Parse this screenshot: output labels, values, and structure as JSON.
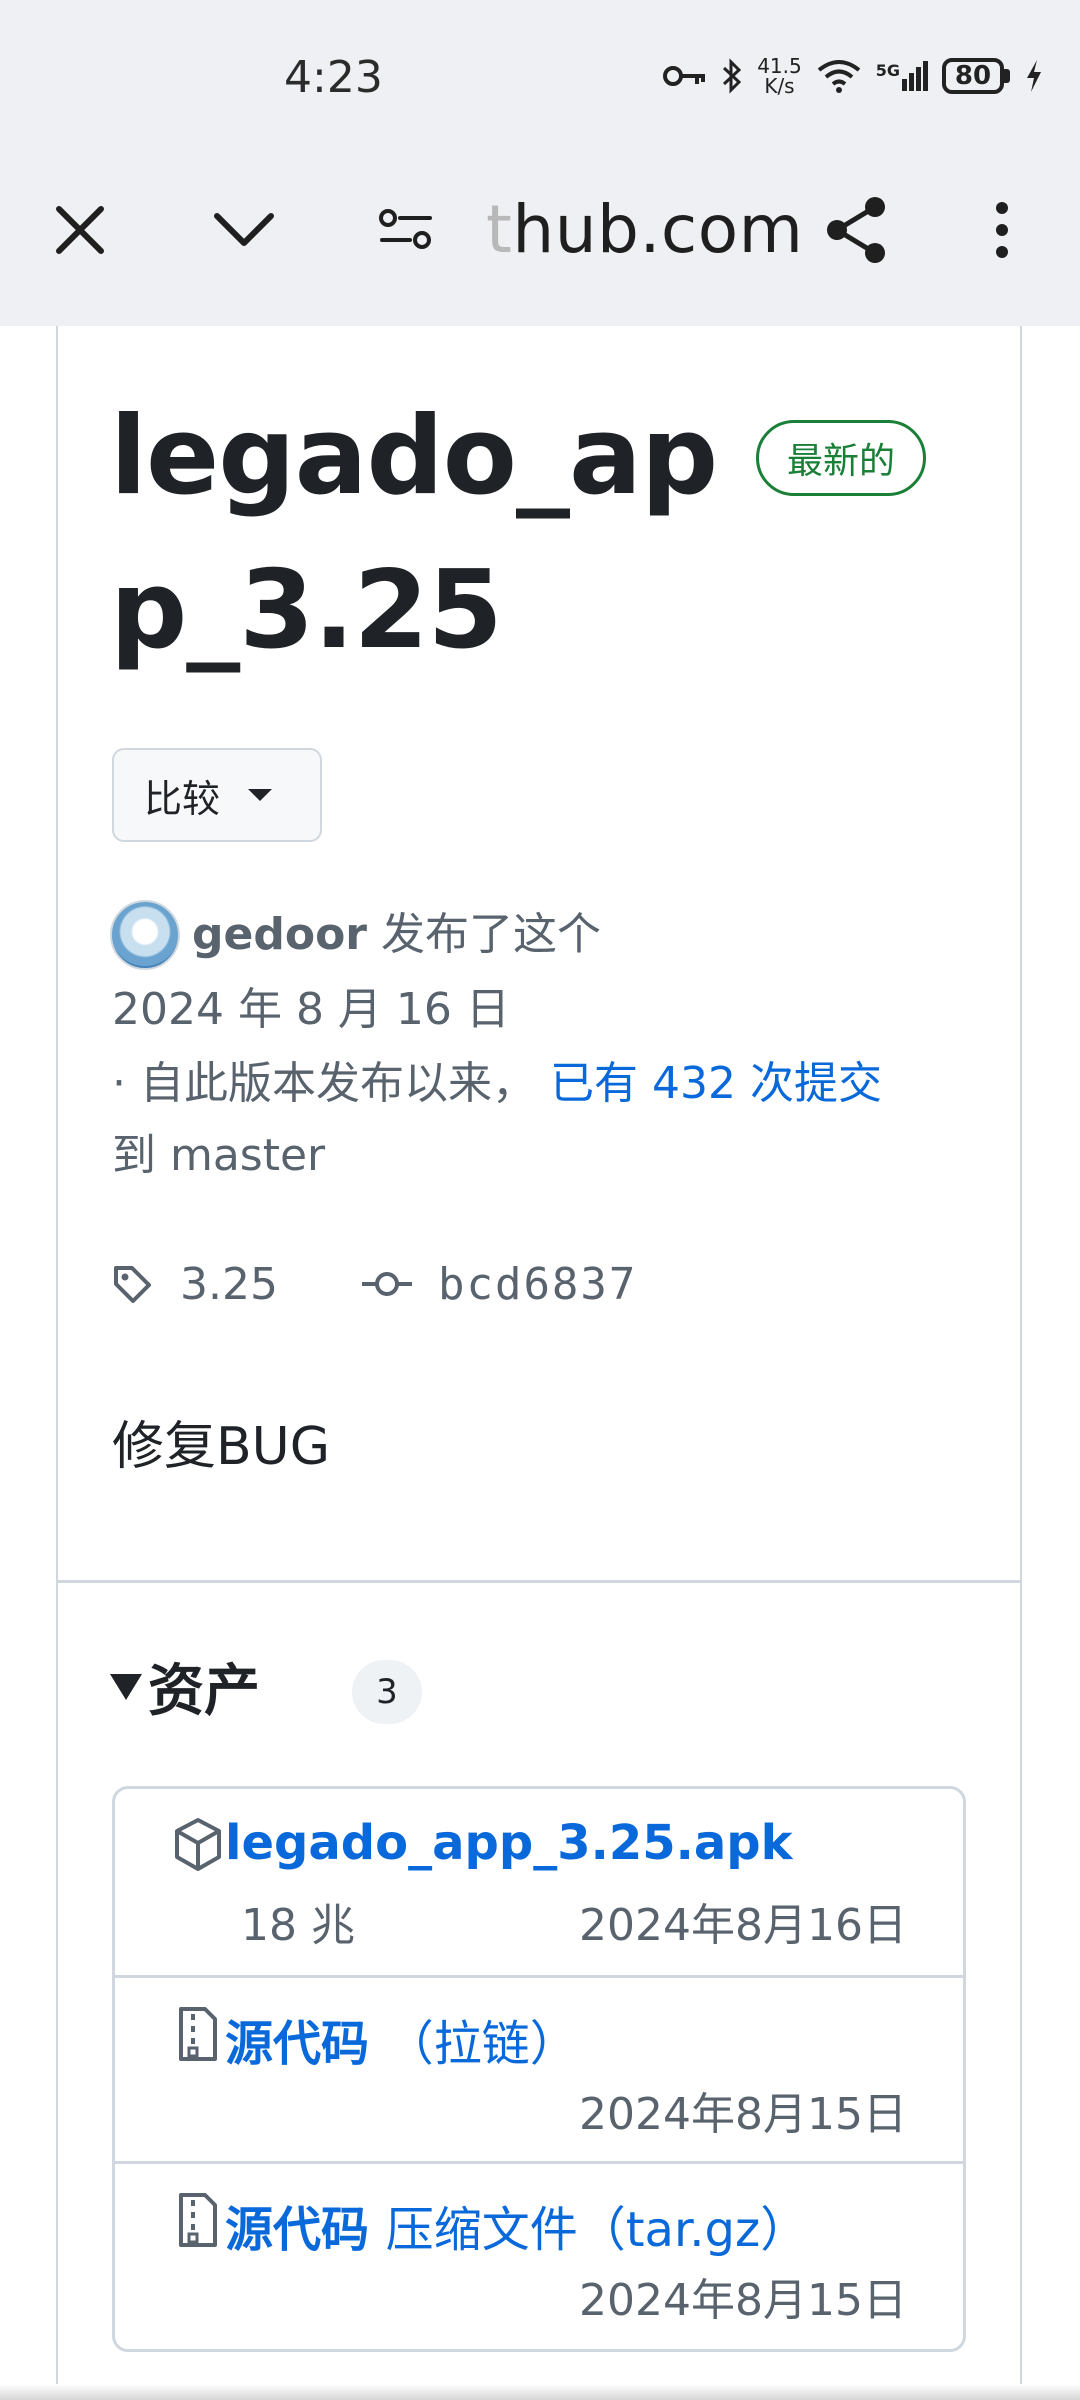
{
  "status_bar": {
    "time": "4:23",
    "net_speed_value": "41.5",
    "net_speed_unit": "K/s",
    "network": "5G",
    "battery": "80"
  },
  "browser": {
    "url_fade": "t",
    "url_main": "hub.com",
    "icons": [
      "close-icon",
      "chevron-down-icon",
      "site-settings-icon",
      "share-icon",
      "more-vert-icon"
    ]
  },
  "release": {
    "title": "legado_app_3.25",
    "latest_badge": "最新的",
    "compare_label": "比较",
    "author": "gedoor",
    "published_text": "发布了这个",
    "date": "2024 年 8 月 16 日",
    "commits_prefix": "· 自此版本发布以来，",
    "commits_link": "已有 432 次提交",
    "commits_suffix": "到 master",
    "tag": "3.25",
    "commit_sha": "bcd6837",
    "notes": "修复BUG"
  },
  "assets": {
    "title": "资产",
    "count": "3",
    "items": [
      {
        "name": "legado_app_3.25.apk",
        "name_plain": "",
        "size": "18 兆",
        "date": "2024年8月16日",
        "icon": "package-icon"
      },
      {
        "name": "源代码",
        "name_plain": "（拉链）",
        "size": "",
        "date": "2024年8月15日",
        "icon": "file-zip-icon"
      },
      {
        "name": "源代码",
        "name_plain": "压缩文件（tar.gz）",
        "size": "",
        "date": "2024年8月15日",
        "icon": "file-zip-icon"
      }
    ]
  },
  "colors": {
    "link": "#0969da",
    "badge_green": "#1a7f37",
    "muted": "#59636e",
    "border": "#d0d7de",
    "toolbar_bg": "#eff0f3"
  }
}
